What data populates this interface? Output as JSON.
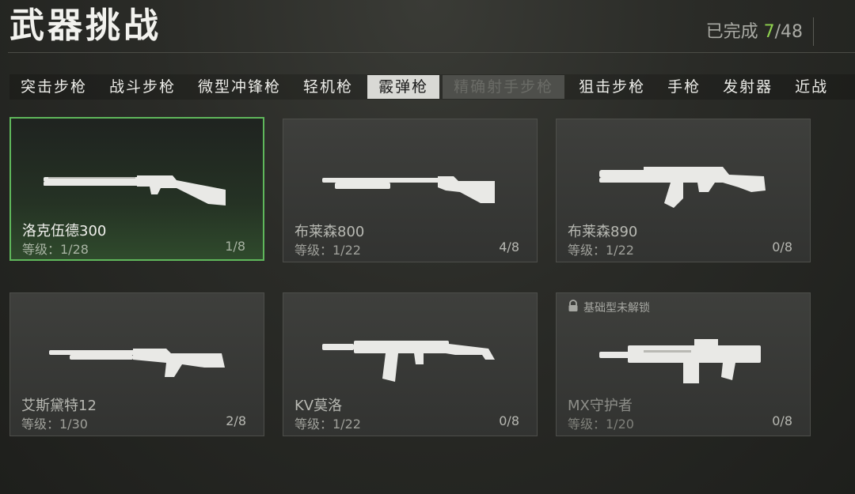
{
  "header": {
    "title": "武器挑战",
    "progress_label": "已完成",
    "progress_done": "7",
    "progress_total": "/48"
  },
  "tabs": [
    {
      "label": "突击步枪",
      "state": "normal"
    },
    {
      "label": "战斗步枪",
      "state": "normal"
    },
    {
      "label": "微型冲锋枪",
      "state": "normal"
    },
    {
      "label": "轻机枪",
      "state": "normal"
    },
    {
      "label": "霰弹枪",
      "state": "active"
    },
    {
      "label": "精确射手步枪",
      "state": "locked"
    },
    {
      "label": "狙击步枪",
      "state": "normal"
    },
    {
      "label": "手枪",
      "state": "normal"
    },
    {
      "label": "发射器",
      "state": "normal"
    },
    {
      "label": "近战",
      "state": "normal"
    }
  ],
  "weapons": [
    {
      "name": "洛克伍德300",
      "level": "等级：1/28",
      "progress": "1/8",
      "icon": "double-barrel-shotgun-icon"
    },
    {
      "name": "布莱森800",
      "level": "等级：1/22",
      "progress": "4/8",
      "icon": "pump-shotgun-icon"
    },
    {
      "name": "布莱森890",
      "level": "等级：1/22",
      "progress": "0/8",
      "icon": "tactical-pump-shotgun-icon"
    },
    {
      "name": "艾斯黛特12",
      "level": "等级：1/30",
      "progress": "2/8",
      "icon": "semi-auto-shotgun-icon"
    },
    {
      "name": "KV莫洛",
      "level": "等级：1/22",
      "progress": "0/8",
      "icon": "magazine-shotgun-icon"
    },
    {
      "name": "MX守护者",
      "level": "等级：1/20",
      "progress": "0/8",
      "icon": "bullpup-shotgun-icon",
      "lock_note": "基础型未解锁"
    }
  ],
  "colors": {
    "accent": "#8fd14f",
    "selected_border": "#5fb75b"
  }
}
